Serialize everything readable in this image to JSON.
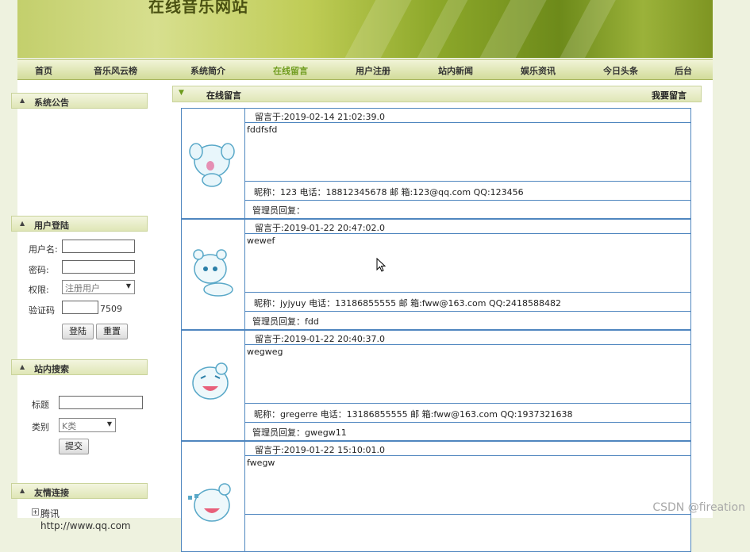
{
  "site": {
    "title": "在线音乐网站"
  },
  "nav": {
    "items": [
      "首页",
      "音乐风云榜",
      "系统简介",
      "在线留言",
      "用户注册",
      "站内新闻",
      "娱乐资讯",
      "今日头条",
      "后台"
    ],
    "active_index": 3
  },
  "sidebar": {
    "notice": {
      "title": "系统公告"
    },
    "login": {
      "title": "用户登陆",
      "username_label": "用户名:",
      "password_label": "密码:",
      "role_label": "权限:",
      "role_value": "注册用户",
      "captcha_label": "验证码",
      "captcha_code": "7509",
      "login_button": "登陆",
      "reset_button": "重置"
    },
    "search": {
      "title": "站内搜索",
      "title_label": "标题",
      "category_label": "类别",
      "category_value": "K类",
      "submit_button": "提交"
    },
    "links": {
      "title": "友情连接",
      "items": [
        "腾讯http://www.qq.com"
      ]
    }
  },
  "main": {
    "title": "在线留言",
    "leave_message": "我要留言",
    "entries": [
      {
        "time": "留言于:2019-02-14 21:02:39.0",
        "content": "fddfsfd",
        "info": "昵称：123    电话：18812345678  邮 箱:123@qq.com    QQ:123456",
        "reply": "管理员回复："
      },
      {
        "time": "留言于:2019-01-22 20:47:02.0",
        "content": "wewef",
        "info": "昵称：jyjyuy    电话：13186855555  邮 箱:fww@163.com    QQ:2418588482",
        "reply": "管理员回复：fdd"
      },
      {
        "time": "留言于:2019-01-22 20:40:37.0",
        "content": "wegweg",
        "info": "昵称：gregerre    电话：13186855555  邮 箱:fww@163.com    QQ:1937321638",
        "reply": "管理员回复：gwegw11"
      },
      {
        "time": "留言于:2019-01-22 15:10:01.0",
        "content": "fwegw",
        "info": "",
        "reply": ""
      }
    ]
  },
  "watermark": "CSDN @fireation",
  "colors": {
    "accent": "#6e9b1d",
    "border_blue": "#4f86bf"
  }
}
